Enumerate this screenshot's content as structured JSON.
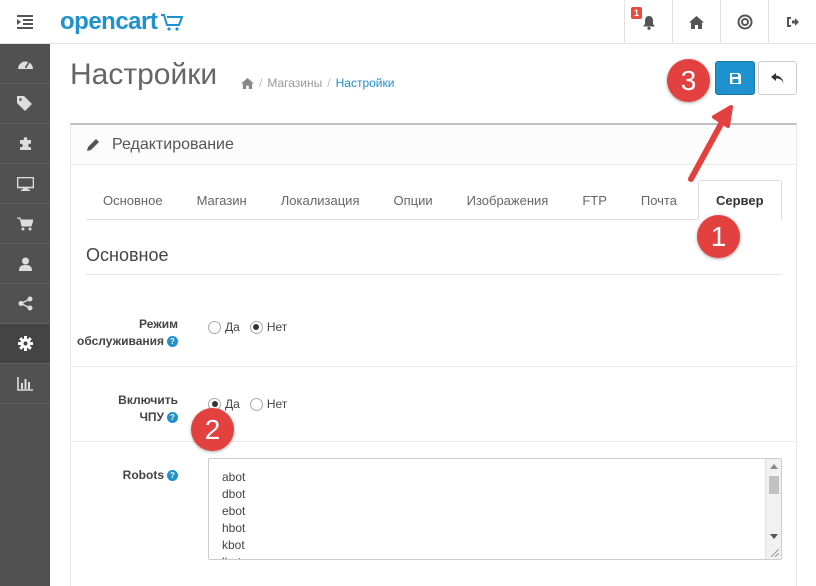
{
  "header": {
    "logo_text": "opencart",
    "notification_count": "1"
  },
  "icons": {
    "menu": "hamburger-indent-icon",
    "bell": "bell-icon",
    "home": "home-icon",
    "help": "life-ring-icon",
    "logout": "sign-out-icon",
    "sidebar": [
      "dashboard-icon",
      "tags-icon",
      "puzzle-icon",
      "desktop-icon",
      "shopping-cart-icon",
      "user-icon",
      "share-icon",
      "gear-icon",
      "bar-chart-icon"
    ]
  },
  "page": {
    "title": "Настройки",
    "breadcrumb": [
      "Магазины",
      "Настройки"
    ]
  },
  "panel": {
    "heading": "Редактирование"
  },
  "tabs": [
    "Основное",
    "Магазин",
    "Локализация",
    "Опции",
    "Изображения",
    "FTP",
    "Почта",
    "Сервер"
  ],
  "active_tab": "Сервер",
  "section": {
    "legend": "Основное",
    "maintenance": {
      "label_line1": "Режим",
      "label_line2": "обслуживания",
      "yes": "Да",
      "no": "Нет",
      "selected": "Нет"
    },
    "seo_url": {
      "label_line1": "Включить",
      "label_line2": "ЧПУ",
      "yes": "Да",
      "no": "Нет",
      "selected": "Да"
    },
    "robots": {
      "label": "Robots",
      "lines": [
        "abot",
        "dbot",
        "ebot",
        "hbot",
        "kbot",
        "lbot"
      ]
    }
  },
  "annotations": [
    "1",
    "2",
    "3"
  ],
  "colors": {
    "accent": "#1e91cf",
    "sidebar": "#515151",
    "annotation": "#e3413f"
  }
}
